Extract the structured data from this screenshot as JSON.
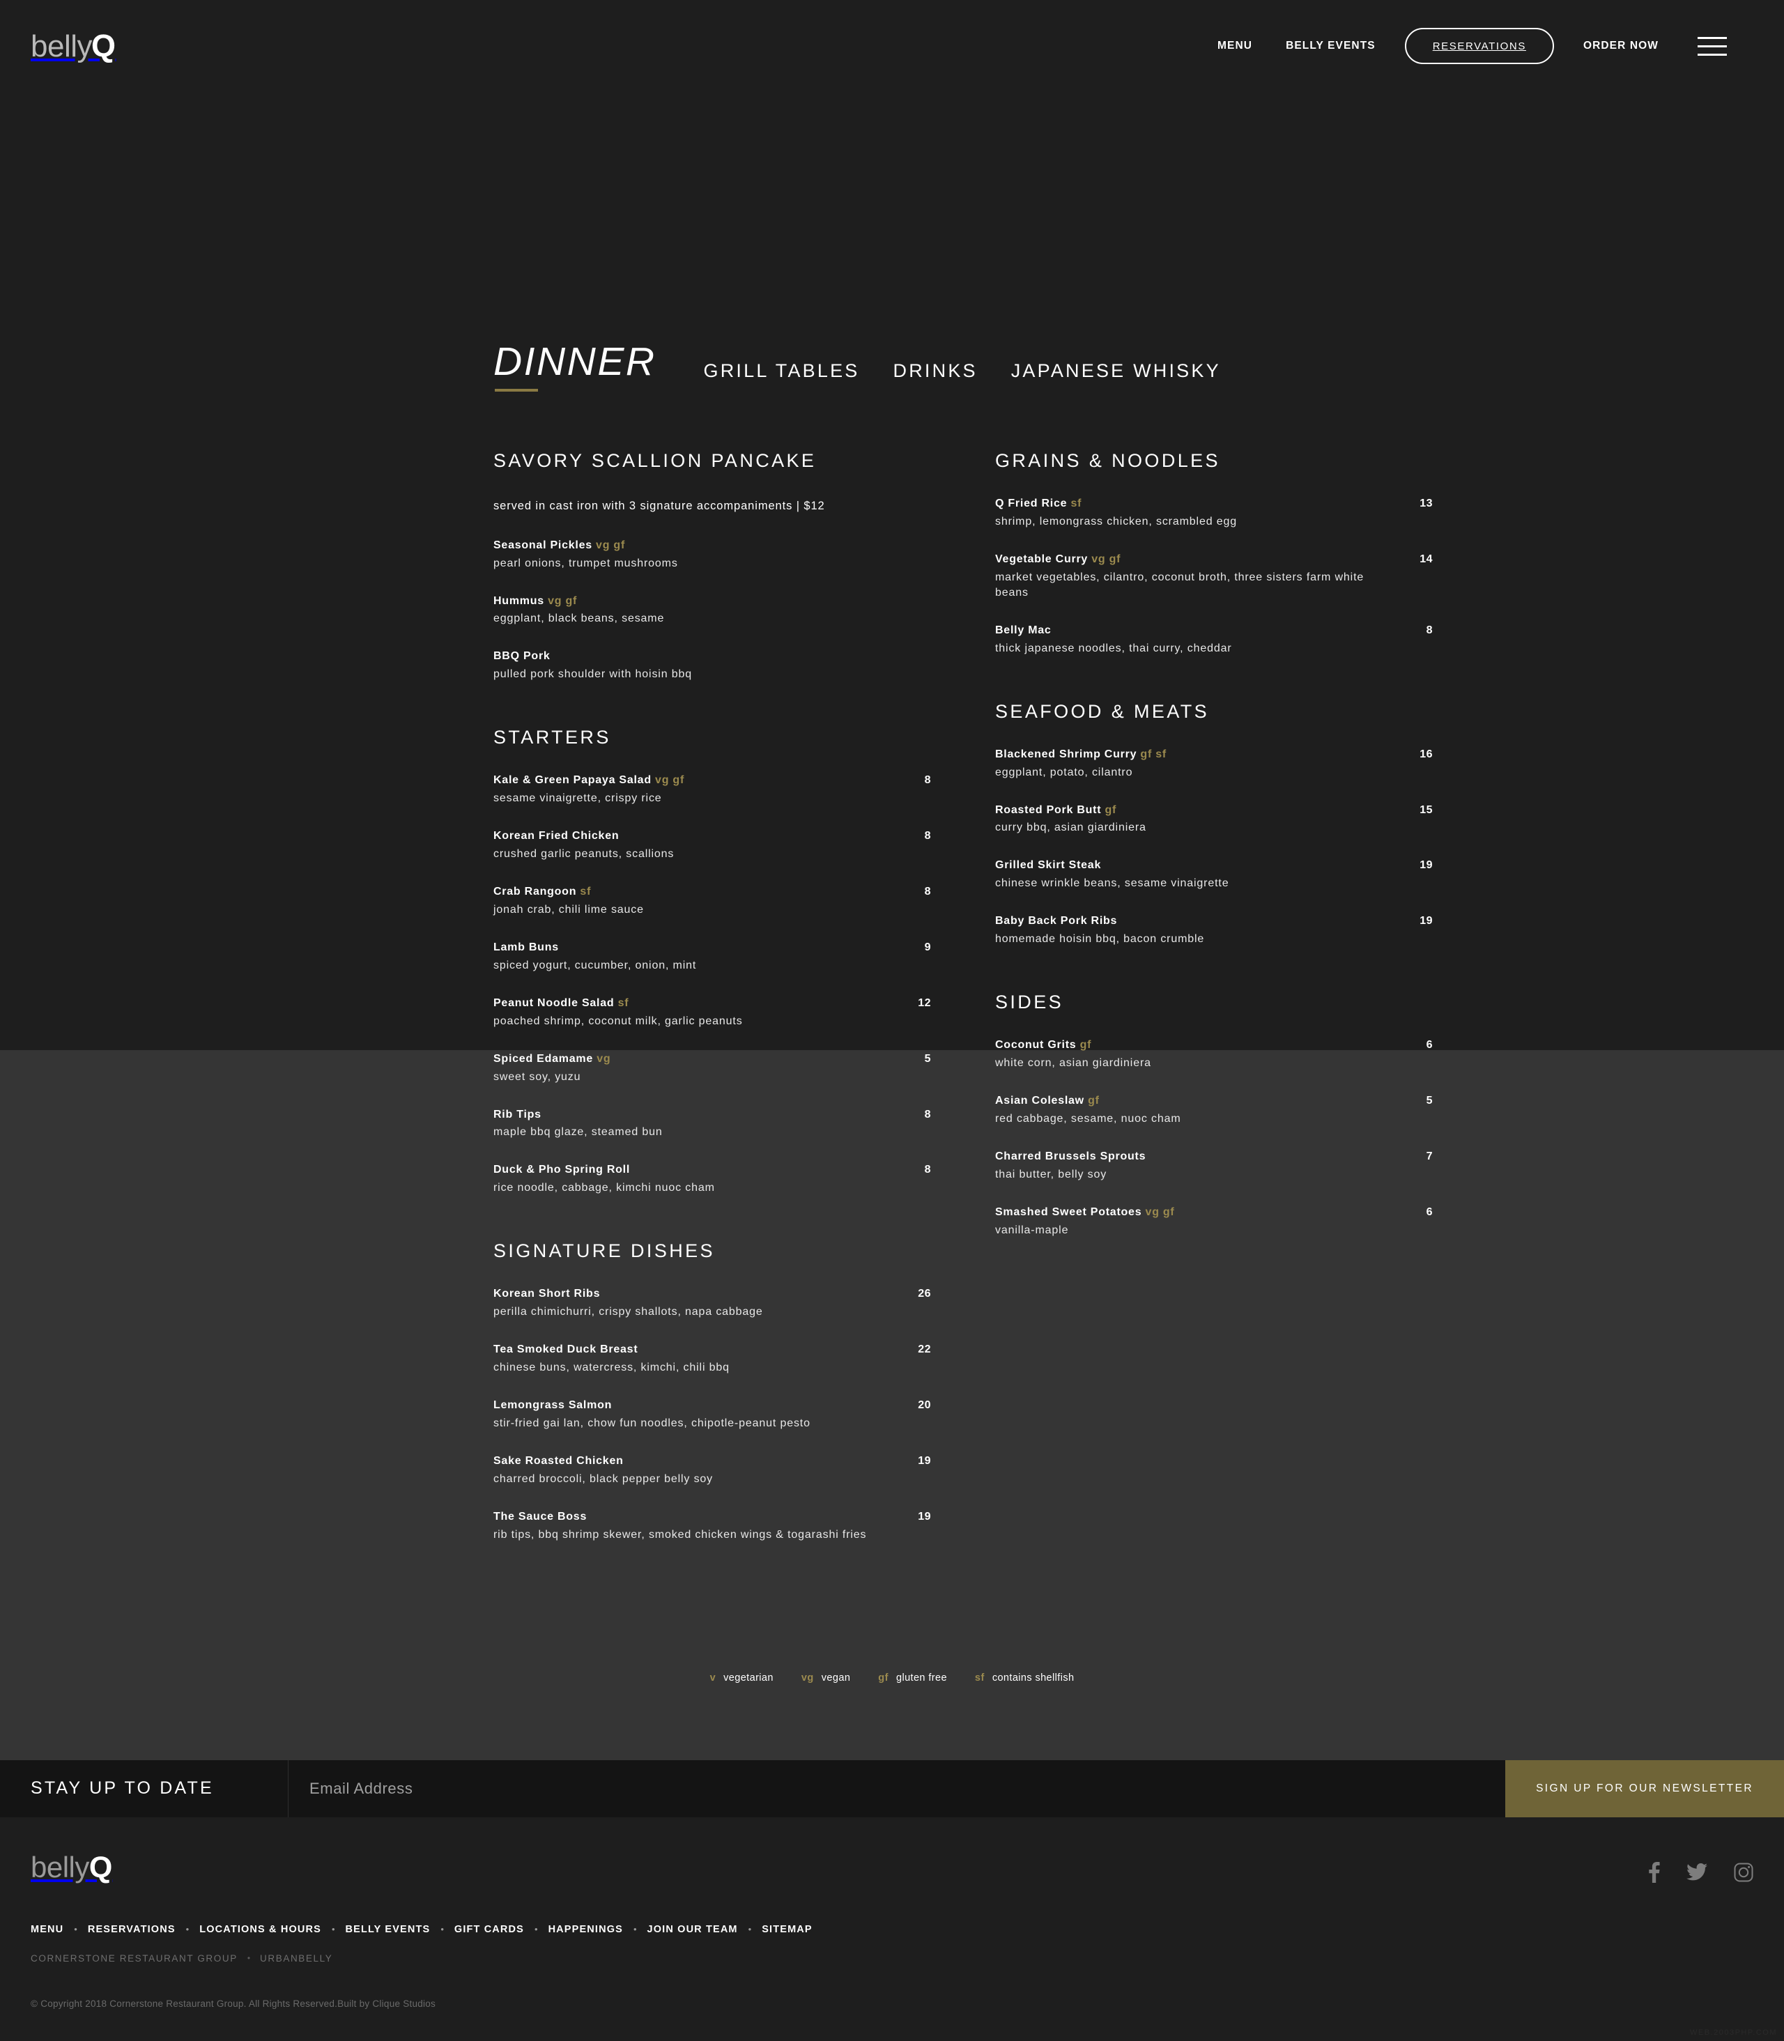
{
  "header": {
    "logo": {
      "light": "belly",
      "bold": "Q"
    },
    "nav": [
      {
        "label": "MENU",
        "name": "nav-menu"
      },
      {
        "label": "BELLY EVENTS",
        "name": "nav-belly-events"
      }
    ],
    "reservations_label": "RESERVATIONS",
    "order_now_label": "ORDER NOW"
  },
  "menu": {
    "title": "DINNER",
    "tabs": [
      {
        "label": "GRILL TABLES"
      },
      {
        "label": "DRINKS"
      },
      {
        "label": "JAPANESE WHISKY"
      }
    ],
    "left_sections": [
      {
        "title": "SAVORY SCALLION PANCAKE",
        "note": "served in cast iron with 3 signature accompaniments | $12",
        "items": [
          {
            "name": "Seasonal Pickles",
            "tags": "vg gf",
            "price": "",
            "desc": "pearl onions, trumpet mushrooms"
          },
          {
            "name": "Hummus",
            "tags": "vg gf",
            "price": "",
            "desc": "eggplant, black beans, sesame"
          },
          {
            "name": "BBQ Pork",
            "tags": "",
            "price": "",
            "desc": "pulled pork shoulder with hoisin bbq"
          }
        ]
      },
      {
        "title": "STARTERS",
        "note": "",
        "items": [
          {
            "name": "Kale & Green Papaya Salad",
            "tags": "vg gf",
            "price": "8",
            "desc": "sesame vinaigrette, crispy rice"
          },
          {
            "name": "Korean Fried Chicken",
            "tags": "",
            "price": "8",
            "desc": "crushed garlic peanuts, scallions"
          },
          {
            "name": "Crab Rangoon",
            "tags": "sf",
            "price": "8",
            "desc": "jonah crab, chili lime sauce"
          },
          {
            "name": "Lamb Buns",
            "tags": "",
            "price": "9",
            "desc": "spiced yogurt, cucumber, onion, mint"
          },
          {
            "name": "Peanut Noodle Salad",
            "tags": "sf",
            "price": "12",
            "desc": "poached shrimp, coconut milk, garlic peanuts"
          },
          {
            "name": "Spiced Edamame",
            "tags": "vg",
            "price": "5",
            "desc": "sweet soy, yuzu"
          },
          {
            "name": "Rib Tips",
            "tags": "",
            "price": "8",
            "desc": "maple bbq glaze, steamed bun"
          },
          {
            "name": "Duck & Pho Spring Roll",
            "tags": "",
            "price": "8",
            "desc": "rice noodle, cabbage, kimchi nuoc cham"
          }
        ]
      },
      {
        "title": "SIGNATURE DISHES",
        "note": "",
        "items": [
          {
            "name": "Korean Short Ribs",
            "tags": "",
            "price": "26",
            "desc": "perilla chimichurri, crispy shallots, napa cabbage"
          },
          {
            "name": "Tea Smoked Duck Breast",
            "tags": "",
            "price": "22",
            "desc": "chinese buns, watercress, kimchi, chili bbq"
          },
          {
            "name": "Lemongrass Salmon",
            "tags": "",
            "price": "20",
            "desc": "stir-fried gai lan, chow fun noodles, chipotle-peanut pesto"
          },
          {
            "name": "Sake Roasted Chicken",
            "tags": "",
            "price": "19",
            "desc": "charred broccoli, black pepper belly soy"
          },
          {
            "name": "The Sauce Boss",
            "tags": "",
            "price": "19",
            "desc": "rib tips, bbq shrimp skewer, smoked chicken wings & togarashi fries"
          }
        ]
      }
    ],
    "right_sections": [
      {
        "title": "GRAINS & NOODLES",
        "note": "",
        "items": [
          {
            "name": "Q Fried Rice",
            "tags": "sf",
            "price": "13",
            "desc": "shrimp, lemongrass chicken, scrambled egg"
          },
          {
            "name": "Vegetable Curry",
            "tags": "vg gf",
            "price": "14",
            "desc": "market vegetables, cilantro, coconut broth, three sisters farm white beans"
          },
          {
            "name": "Belly Mac",
            "tags": "",
            "price": "8",
            "desc": "thick japanese noodles, thai curry, cheddar"
          }
        ]
      },
      {
        "title": "SEAFOOD & MEATS",
        "note": "",
        "items": [
          {
            "name": "Blackened Shrimp Curry",
            "tags": "gf sf",
            "price": "16",
            "desc": "eggplant, potato, cilantro"
          },
          {
            "name": "Roasted Pork Butt",
            "tags": "gf",
            "price": "15",
            "desc": "curry bbq, asian giardiniera"
          },
          {
            "name": "Grilled Skirt Steak",
            "tags": "",
            "price": "19",
            "desc": "chinese wrinkle beans, sesame vinaigrette"
          },
          {
            "name": "Baby Back Pork Ribs",
            "tags": "",
            "price": "19",
            "desc": "homemade hoisin bbq, bacon crumble"
          }
        ]
      },
      {
        "title": "SIDES",
        "note": "",
        "items": [
          {
            "name": "Coconut Grits",
            "tags": "gf",
            "price": "6",
            "desc": "white corn, asian giardiniera"
          },
          {
            "name": "Asian Coleslaw",
            "tags": "gf",
            "price": "5",
            "desc": "red cabbage, sesame, nuoc cham"
          },
          {
            "name": "Charred Brussels Sprouts",
            "tags": "",
            "price": "7",
            "desc": "thai butter, belly soy"
          },
          {
            "name": "Smashed Sweet Potatoes",
            "tags": "vg gf",
            "price": "6",
            "desc": "vanilla-maple"
          }
        ]
      }
    ],
    "legend": [
      {
        "code": "v",
        "label": "vegetarian"
      },
      {
        "code": "vg",
        "label": "vegan"
      },
      {
        "code": "gf",
        "label": "gluten free"
      },
      {
        "code": "sf",
        "label": "contains shellfish"
      }
    ]
  },
  "newsletter": {
    "title": "STAY UP TO DATE",
    "placeholder": "Email Address",
    "value": "",
    "button_label": "SIGN UP FOR OUR NEWSLETTER"
  },
  "footer": {
    "logo": {
      "light": "belly",
      "bold": "Q"
    },
    "social": [
      {
        "name": "facebook-icon"
      },
      {
        "name": "twitter-icon"
      },
      {
        "name": "instagram-icon"
      }
    ],
    "nav": [
      "MENU",
      "RESERVATIONS",
      "LOCATIONS & HOURS",
      "BELLY EVENTS",
      "GIFT CARDS",
      "HAPPENINGS",
      "JOIN OUR TEAM",
      "SITEMAP"
    ],
    "subnav": [
      "CORNERSTONE RESTAURANT GROUP",
      "URBANBELLY"
    ],
    "copyright": "© Copyright 2018 Cornerstone Restaurant Group. All Rights Reserved.Built by Clique Studios",
    "watermark": "WEB.2003PHP.COM"
  },
  "colors": {
    "background_dark": "#1e1e1e",
    "background_light": "#353535",
    "accent_gold": "#9b8a4e",
    "newsletter_button": "#6f6437",
    "underline_gold": "#8a7a43"
  }
}
